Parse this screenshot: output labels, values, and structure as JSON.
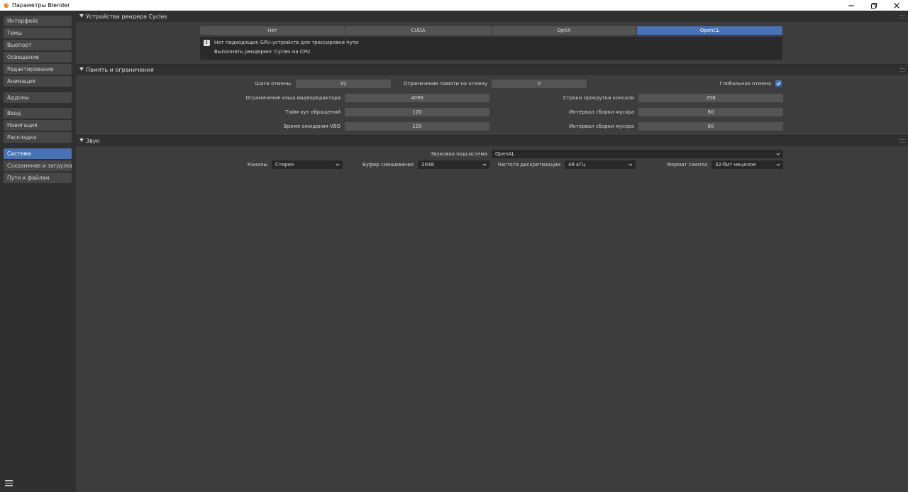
{
  "window": {
    "title": "Параметры Blender",
    "accent": "#4772b3"
  },
  "sidebar": {
    "items": [
      {
        "label": "Интерфейс"
      },
      {
        "label": "Темы"
      },
      {
        "label": "Вьюпорт"
      },
      {
        "label": "Освещение"
      },
      {
        "label": "Редактирование"
      },
      {
        "label": "Анимация"
      },
      {
        "label": "Аддоны"
      },
      {
        "label": "Ввод"
      },
      {
        "label": "Навигация"
      },
      {
        "label": "Раскладка"
      },
      {
        "label": "Система",
        "active": true
      },
      {
        "label": "Сохранение и загрузка"
      },
      {
        "label": "Пути к файлам"
      }
    ]
  },
  "cycles": {
    "title": "Устройства рендера Cycles",
    "devices": [
      "Нет",
      "CUDA",
      "OptiX",
      "OpenCL"
    ],
    "selected_device": "OpenCL",
    "info_line1": "Нет подходящих GPU-устройств для трассировки пути",
    "info_line2": "Выполнять рендеринг Cycles на CPU"
  },
  "memory": {
    "title": "Память и ограничения",
    "undo_steps_label": "Шаги отмены",
    "undo_steps": "32",
    "undo_memory_label": "Ограничение памяти на отмену",
    "undo_memory": "0",
    "global_undo_label": "Глобальная отмена",
    "global_undo": true,
    "vse_cache_label": "Ограничение кэша видеоредактора",
    "vse_cache": "4096",
    "console_lines_label": "Строки прокрутки консоли",
    "console_lines": "256",
    "timeout_label": "Тайм-аут обращений",
    "timeout": "120",
    "gc_interval_label": "Интервал сборки мусора",
    "gc_interval": "60",
    "vbo_time_label": "Время ожидания VBO",
    "vbo_time": "120",
    "gc_interval2_label": "Интервал сборки мусора",
    "gc_interval2": "60"
  },
  "sound": {
    "title": "Звук",
    "device_label": "Звуковая подсистема",
    "device": "OpenAL",
    "channels_label": "Каналы",
    "channels": "Стерео",
    "buffer_label": "Буфер смешивания",
    "buffer": "2048",
    "rate_label": "Частота дискретизации",
    "rate": "48 кГц",
    "format_label": "Формат сэмпла",
    "format": "32-бит нецелое"
  }
}
